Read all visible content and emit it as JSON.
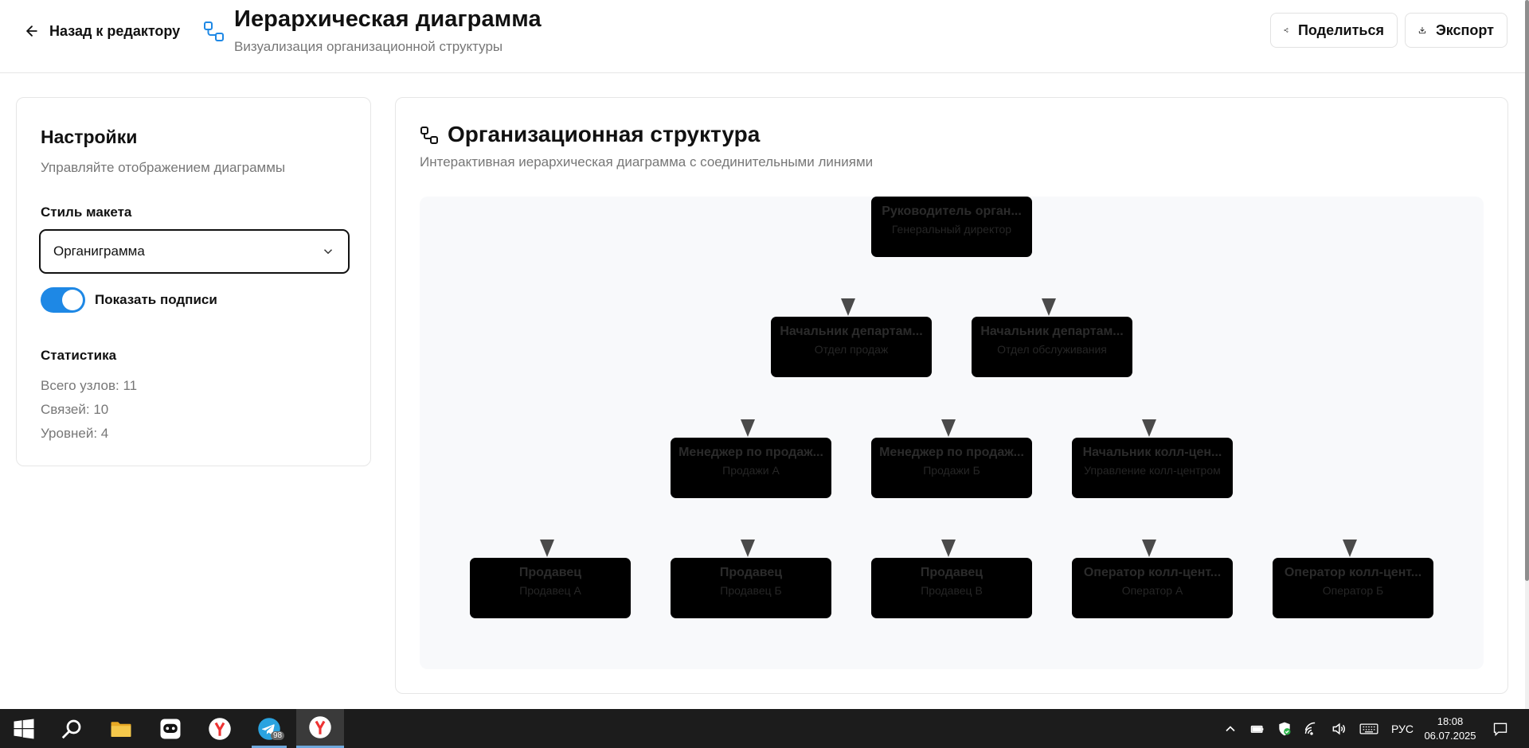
{
  "header": {
    "back_label": "Назад к редактору",
    "title": "Иерархическая диаграмма",
    "subtitle": "Визуализация организационной структуры",
    "share_label": "Поделиться",
    "export_label": "Экспорт"
  },
  "settings": {
    "title": "Настройки",
    "description": "Управляйте отображением диаграммы",
    "layout_label": "Стиль макета",
    "layout_value": "Органиграмма",
    "toggle_label": "Показать подписи",
    "toggle_on": true,
    "stats_title": "Статистика",
    "stats": [
      "Всего узлов: 11",
      "Связей: 10",
      "Уровней: 4"
    ]
  },
  "diagram": {
    "title": "Организационная структура",
    "description": "Интерактивная иерархическая диаграмма с соединительными линиями",
    "nodes": [
      {
        "title": "Руководитель орган...",
        "subtitle": "Генеральный директор"
      },
      {
        "title": "Начальник департам...",
        "subtitle": "Отдел продаж"
      },
      {
        "title": "Начальник департам...",
        "subtitle": "Отдел обслуживания"
      },
      {
        "title": "Менеджер по продаж...",
        "subtitle": "Продажи А"
      },
      {
        "title": "Менеджер по продаж...",
        "subtitle": "Продажи Б"
      },
      {
        "title": "Начальник колл-цен...",
        "subtitle": "Управление колл-центром"
      },
      {
        "title": "Продавец",
        "subtitle": "Продавец А"
      },
      {
        "title": "Продавец",
        "subtitle": "Продавец Б"
      },
      {
        "title": "Продавец",
        "subtitle": "Продавец В"
      },
      {
        "title": "Оператор колл-цент...",
        "subtitle": "Оператор А"
      },
      {
        "title": "Оператор колл-цент...",
        "subtitle": "Оператор Б"
      }
    ]
  },
  "taskbar": {
    "telegram_badge": "98",
    "language": "РУС",
    "time": "18:08",
    "date": "06.07.2025"
  },
  "colors": {
    "accent": "#1e88e5",
    "node_fill": "#000000",
    "arrow": "#4a4a4a",
    "canvas": "#f8f9fb"
  }
}
